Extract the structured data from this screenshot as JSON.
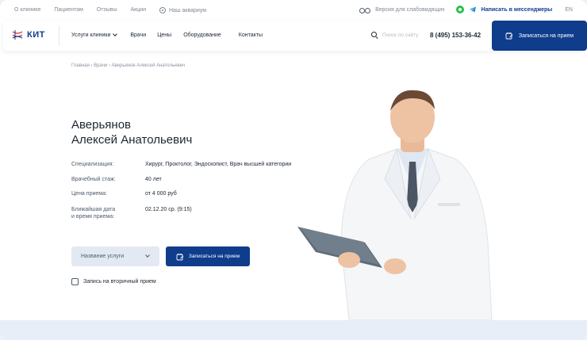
{
  "topbar": {
    "links": [
      "О клинике",
      "Пациентам",
      "Отзывы",
      "Акции"
    ],
    "aquarium": "Наш аквариум",
    "accessibility": "Версия для слабовидящих",
    "messengers": "Написать в мессенджеры",
    "language": "EN"
  },
  "header": {
    "logo_text": "КИТ",
    "nav": {
      "services": "Услуги клиники",
      "doctors": "Врачи",
      "prices": "Цены",
      "equipment": "Оборудование",
      "contacts": "Контакты"
    },
    "search_placeholder": "Поиск по сайту",
    "phone": "8 (495) 153-36-42",
    "cta": "Записаться на прием"
  },
  "breadcrumb": "Главная  ›  Врачи  ›  Аверьянов Алексей Анатольевич",
  "doctor": {
    "last_name": "Аверьянов",
    "first_names": "Алексей Анатольевич",
    "fields": [
      {
        "label": "Специализация:",
        "value": "Хирург, Проктолог, Эндоскопист, Врач высшей категории"
      },
      {
        "label": "Врачебный стаж:",
        "value": "40 лет"
      },
      {
        "label": "Цена приема:",
        "value": "от 4 000 руб"
      },
      {
        "label_line1": "Ближайшая дата",
        "label_line2": "и время приема:",
        "value": "02.12.20 ср. (9:15)"
      }
    ]
  },
  "booking": {
    "service_select": "Название услуги",
    "button": "Записаться на прием",
    "secondary_checkbox": "Запись на вторичный прием"
  },
  "colors": {
    "brand": "#0f3d8c",
    "select_bg": "#e3e9f3",
    "whatsapp": "#28c14a",
    "telegram": "#1f8fd8"
  }
}
